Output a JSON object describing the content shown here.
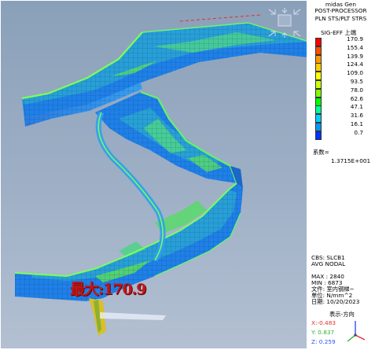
{
  "header": {
    "app_name": "midas Gen",
    "mode": "POST-PROCESSOR",
    "result_type": "PLN STS/PLT STRS",
    "component": "SIG-EFF 上端"
  },
  "legend": {
    "ticks": [
      "170.9",
      "155.4",
      "139.9",
      "124.4",
      "109.0",
      "93.5",
      "78.0",
      "62.6",
      "47.1",
      "31.6",
      "16.1",
      "0.7"
    ],
    "colors": [
      "#ff0000",
      "#ff4d00",
      "#ff9900",
      "#ffcc00",
      "#ffff00",
      "#ccff00",
      "#80ff00",
      "#00ff00",
      "#00ff99",
      "#00d0ff",
      "#0099ff",
      "#0033ff"
    ]
  },
  "factor": {
    "label": "系数=",
    "value": "1.3715E+001"
  },
  "info": {
    "cbs": "CBS: SLCB1",
    "nodal": "AVG NODAL",
    "max": "MAX : 2840",
    "min": "MIN : 6873",
    "file": "文件: 室内钢梯~",
    "unit": "单位: N/mm^2",
    "date": "日期: 10/20/2023",
    "view_direction": "表示-方向"
  },
  "axes": {
    "x": "X:-0.483",
    "y": "Y: 0.837",
    "z": "Z: 0.259"
  },
  "marker": {
    "max_label": "最大:170.9"
  },
  "icons": {
    "view_cube": "view-cube-icon",
    "triad": "axis-triad-icon"
  }
}
